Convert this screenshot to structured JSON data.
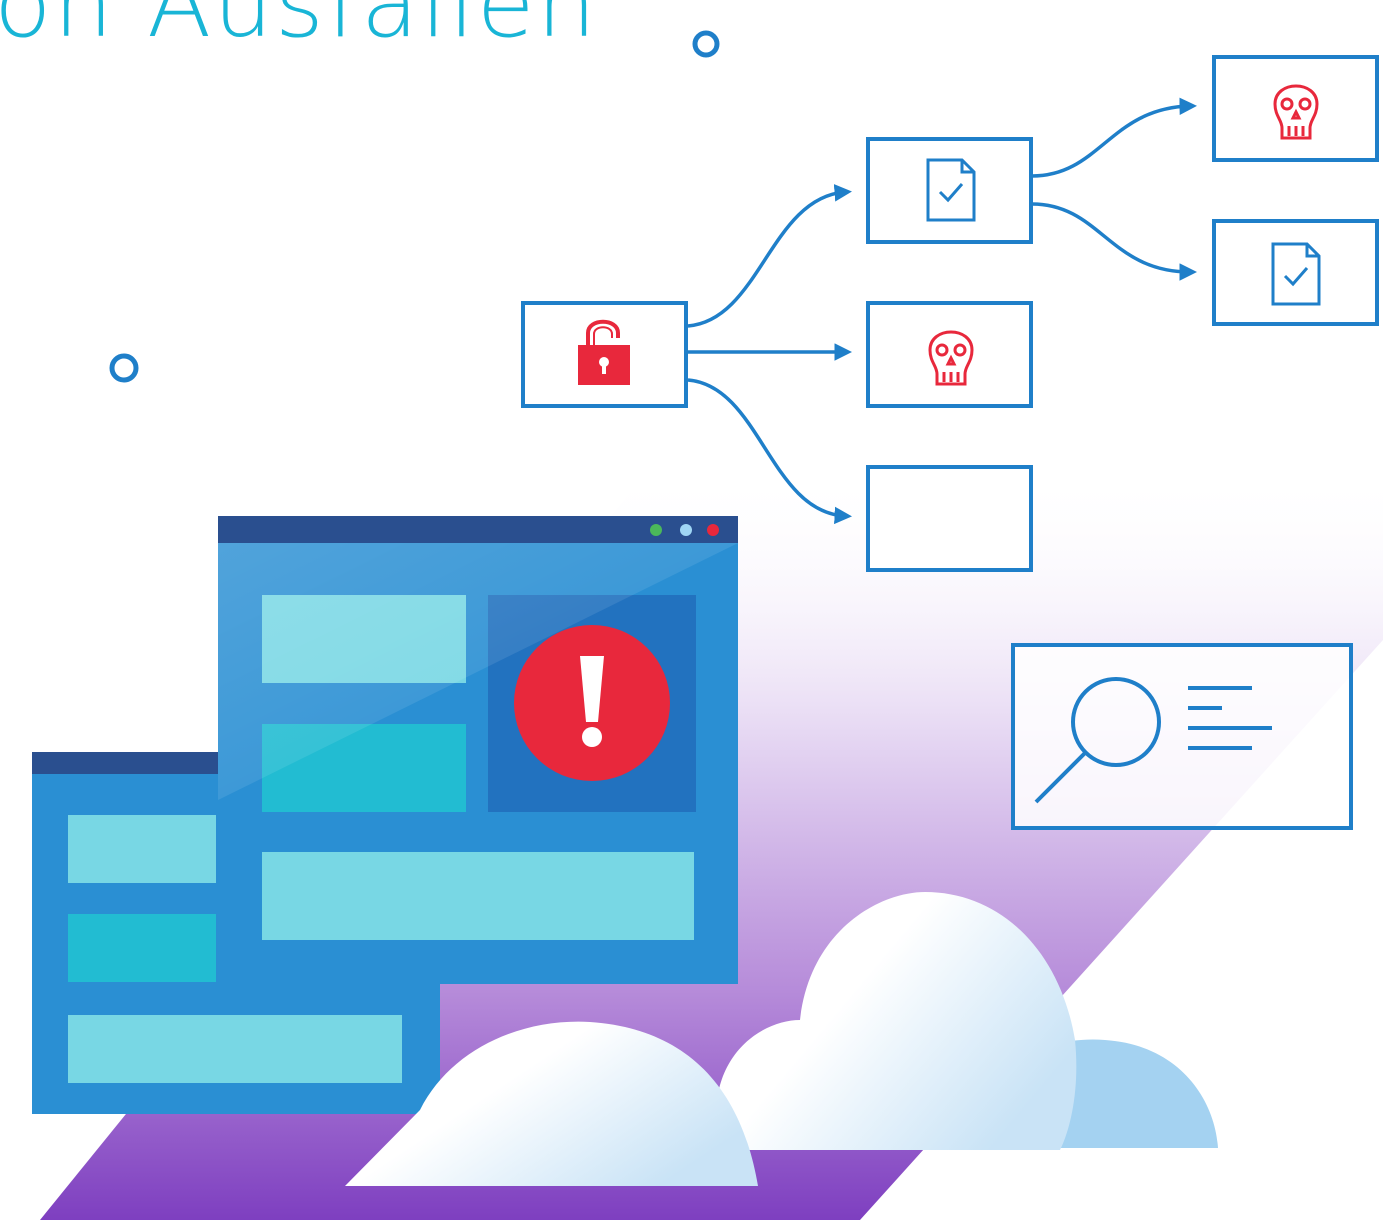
{
  "headline": "on Ausfällen",
  "colors": {
    "headline": "#19b5d6",
    "outline_blue": "#1f7fc9",
    "alert_red": "#e8283c",
    "window_blue": "#2a8fd3",
    "window_titlebar": "#2a4f8f",
    "panel_light": "#78d7e4",
    "panel_teal": "#22bcd2",
    "floor_purple": "#8a4bc7",
    "cloud_blue": "#a4d2f1"
  },
  "icons": {
    "source": "unlocked-padlock-icon",
    "branch_1": "document-check-icon",
    "branch_2": "skull-icon",
    "branch_3": "empty",
    "leaf_1": "skull-icon",
    "leaf_2": "document-check-icon",
    "window_alert": "exclamation-icon",
    "inspector": "magnifier-icon"
  },
  "window_dots": [
    "#4bb85a",
    "#9fd6f5",
    "#e8283c"
  ]
}
